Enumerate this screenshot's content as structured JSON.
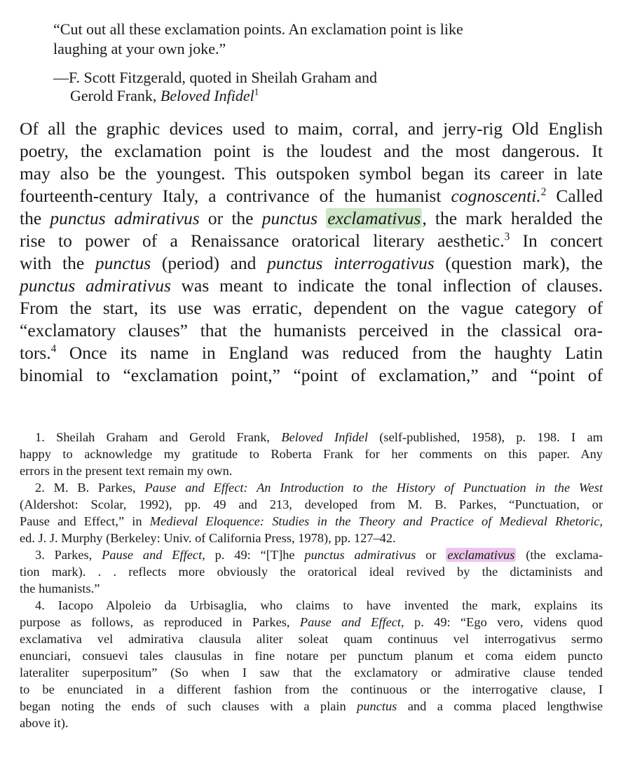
{
  "epigraph": {
    "quote_line1": "“Cut out all these exclamation points. An exclamation point is like",
    "quote_line2": "laughing at your own joke.”",
    "attrib_line1": "—F. Scott Fitzgerald, quoted in Sheilah Graham and",
    "attrib_line2_plain": "Gerold Frank, ",
    "attrib_line2_italic": "Beloved Infidel",
    "attrib_note": "1"
  },
  "body": {
    "l1": "Of all the graphic devices used to maim, corral, and jerry-rig Old English",
    "l2": "poetry, the exclamation point is the loudest and the most dangerous. It",
    "l3": "may also be the youngest. This outspoken symbol began its career in late",
    "l4a": "fourteenth-century Italy, a contrivance of the humanist ",
    "l4i": "cognoscenti.",
    "l4n": "2",
    "l4b": " Called",
    "l5a": "the ",
    "l5i1": "punctus admirativus",
    "l5b": " or the ",
    "l5i2": "punctus",
    "l5c": " ",
    "l5hl": "exclamativus",
    "l5d": ", the mark heralded the",
    "l6a": "rise to power of a Renaissance oratorical literary aesthetic.",
    "l6n": "3",
    "l6b": " In concert",
    "l7a": "with the ",
    "l7i1": "punctus",
    "l7b": " (period) and ",
    "l7i2": "punctus interrogativus",
    "l7c": " (question mark), the",
    "l8i": "punctus admirativus",
    "l8b": " was meant to indicate the tonal inflection of clauses.",
    "l9": "From the start, its use was erratic, dependent on the vague category of",
    "l10": "“exclamatory clauses” that the humanists perceived in the classical ora-",
    "l11a": "tors.",
    "l11n": "4",
    "l11b": " Once its name in England was reduced from the haughty Latin",
    "l12": "binomial to “exclamation point,” “point of exclamation,” and “point of"
  },
  "notes": {
    "n1a": "1. Sheilah Graham and Gerold Frank, ",
    "n1i": "Beloved Infidel",
    "n1b": " (self-published, 1958), p. 198. I am",
    "n1l2": "happy to acknowledge my gratitude to Roberta Frank for her comments on this paper. Any",
    "n1l3": "errors in the present text remain my own.",
    "n2a": "2. M. B. Parkes, ",
    "n2i": "Pause and Effect: An Introduction to the History of Punctuation in the West",
    "n2l2": "(Aldershot: Scolar, 1992), pp. 49 and 213, developed from M. B. Parkes, “Punctuation, or",
    "n2l3a": "Pause and Effect,” in ",
    "n2l3i": "Medieval Eloquence: Studies in the Theory and Practice of Medieval Rhetoric,",
    "n2l4": "ed. J. J. Murphy (Berkeley: Univ. of California Press, 1978), pp. 127–42.",
    "n3a": "3. Parkes, ",
    "n3i1": "Pause and Effect,",
    "n3b": " p. 49: “[T]he ",
    "n3i2": "punctus admirativus",
    "n3c": " or ",
    "n3hl": "exclamativus",
    "n3d": " (the exclama-",
    "n3l2": "tion mark). . . reflects more obviously the oratorical ideal revived by the dictaminists and",
    "n3l3": "the humanists.”",
    "n4l1": "4. Iacopo Alpoleio da Urbisaglia, who claims to have invented the mark, explains its",
    "n4l2a": "purpose as follows, as reproduced in Parkes, ",
    "n4l2i": "Pause and Effect,",
    "n4l2b": " p. 49: “Ego vero, videns quod",
    "n4l3": "exclamativa vel admirativa clausula aliter soleat quam continuus vel interrogativus sermo",
    "n4l4": "enunciari, consuevi tales clausulas in fine notare per punctum planum et coma eidem puncto",
    "n4l5": "lateraliter superpositum” (So when I saw that the exclamatory or admirative clause tended",
    "n4l6": "to be enunciated in a different fashion from the continuous or the interrogative clause, I",
    "n4l7a": "began noting the ends of such clauses with a plain ",
    "n4l7i": "punctus",
    "n4l7b": " and a comma placed lengthwise",
    "n4l8": "above it)."
  },
  "colors": {
    "highlight_green": "#cfe6c9",
    "highlight_pink": "#ecc6ec"
  }
}
